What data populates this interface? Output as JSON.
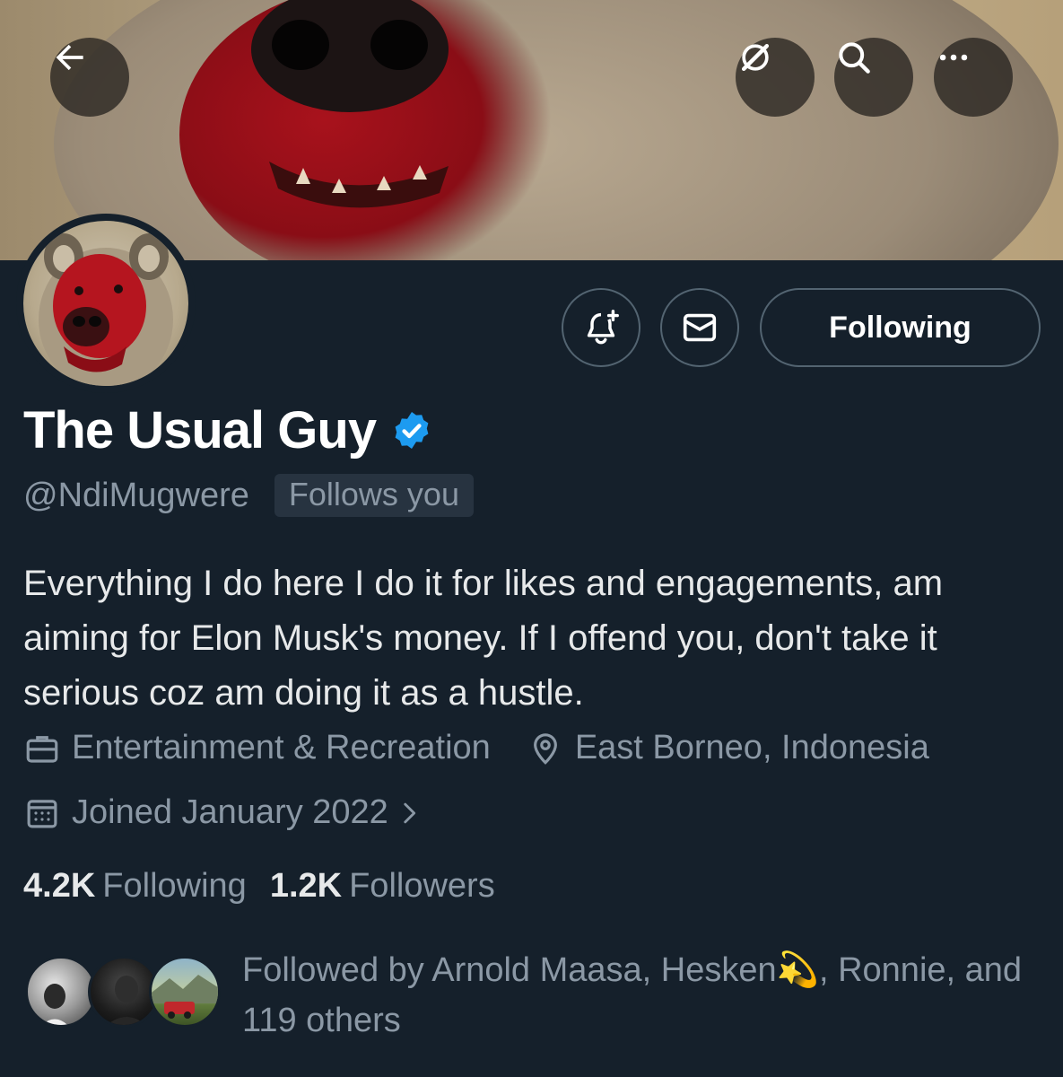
{
  "profile": {
    "name": "The Usual Guy",
    "handle": "@NdiMugwere",
    "follows_you": "Follows you",
    "verified": true,
    "bio": "Everything I do here I do it for likes and engagements, am aiming for Elon Musk's money. If I offend you, don't take it serious coz am doing it as a hustle.",
    "category": "Entertainment & Recreation",
    "location": "East Borneo, Indonesia",
    "joined": "Joined January 2022",
    "following_count": "4.2K",
    "following_label": "Following",
    "followers_count": "1.2K",
    "followers_label": "Followers",
    "followed_by_text": "Followed by Arnold Maasa, Hesken",
    "followed_by_emoji": "💫",
    "followed_by_rest": ", Ronnie, and 119 others"
  },
  "actions": {
    "following_button": "Following"
  },
  "icons": {
    "back": "back-arrow-icon",
    "grok": "grok-icon",
    "search": "search-icon",
    "more": "more-icon",
    "notify": "bell-plus-icon",
    "message": "envelope-icon",
    "category": "briefcase-icon",
    "location": "location-pin-icon",
    "calendar": "calendar-icon",
    "chevron": "chevron-right-icon"
  },
  "colors": {
    "background": "#15202b",
    "secondary_text": "#8b98a5",
    "verified_blue": "#1d9bf0",
    "border": "#536471"
  }
}
